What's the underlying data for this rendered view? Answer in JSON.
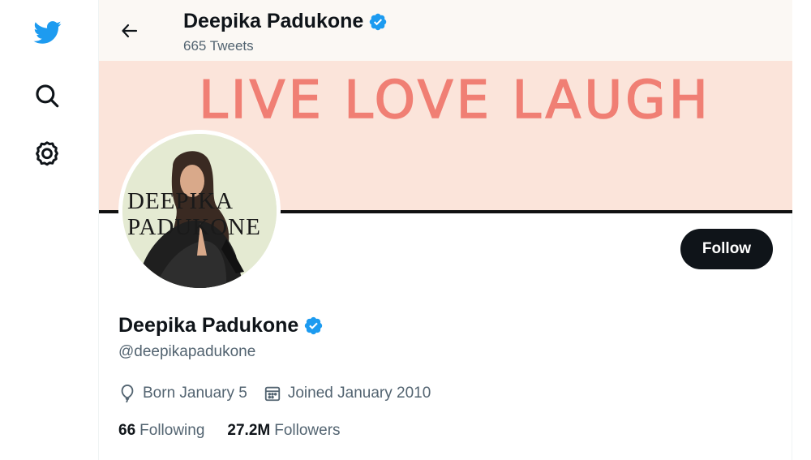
{
  "nav": {
    "logo_icon": "twitter-bird-icon",
    "search_icon": "search-icon",
    "settings_icon": "gear-icon"
  },
  "header": {
    "back_icon": "arrow-left-icon",
    "name": "Deepika Padukone",
    "tweet_count": "665 Tweets"
  },
  "banner": {
    "text": "LIVE LOVE LAUGH",
    "background_color": "#fbe4da",
    "text_color": "#f07f74"
  },
  "avatar": {
    "text_line1": "DEEPIKA",
    "text_line2": "PADUKONE"
  },
  "profile": {
    "name": "Deepika Padukone",
    "verified_icon": "verified-badge-icon",
    "handle": "@deepikapadukone",
    "birthday": "Born January 5",
    "birthday_icon": "balloon-icon",
    "joined": "Joined January 2010",
    "joined_icon": "calendar-icon"
  },
  "actions": {
    "follow_label": "Follow"
  },
  "stats": {
    "following_count": "66",
    "following_label": "Following",
    "followers_count": "27.2M",
    "followers_label": "Followers"
  },
  "colors": {
    "brand_blue": "#1d9bf0",
    "text_primary": "#0f1419",
    "text_secondary": "#536471"
  }
}
